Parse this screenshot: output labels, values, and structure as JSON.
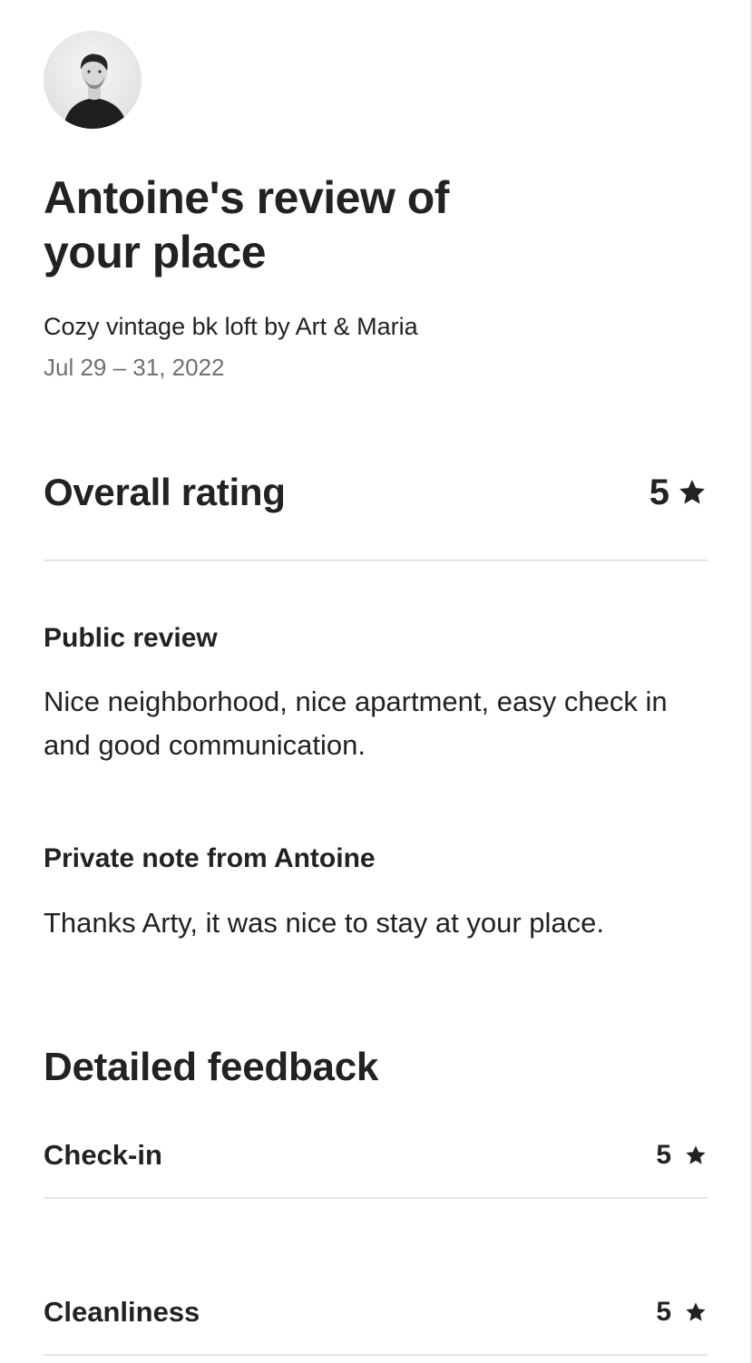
{
  "review": {
    "title": "Antoine's review of your place",
    "listing_name": "Cozy vintage bk loft by Art & Maria",
    "stay_dates": "Jul 29 – 31, 2022",
    "reviewer_avatar_icon": "reviewer-avatar-photo"
  },
  "overall": {
    "label": "Overall rating",
    "value": "5",
    "icon": "star-icon"
  },
  "public_review": {
    "label": "Public review",
    "text": "Nice neighborhood, nice apartment, easy check in and good communication."
  },
  "private_note": {
    "label": "Private note from Antoine",
    "text": "Thanks Arty, it was nice to stay at your place."
  },
  "detailed_feedback": {
    "heading": "Detailed feedback",
    "items": [
      {
        "label": "Check-in",
        "value": "5",
        "icon": "star-icon"
      },
      {
        "label": "Cleanliness",
        "value": "5",
        "icon": "star-icon"
      }
    ]
  },
  "colors": {
    "text_primary": "#222222",
    "text_secondary": "#717171",
    "divider": "#e3e3e3",
    "background": "#ffffff"
  }
}
